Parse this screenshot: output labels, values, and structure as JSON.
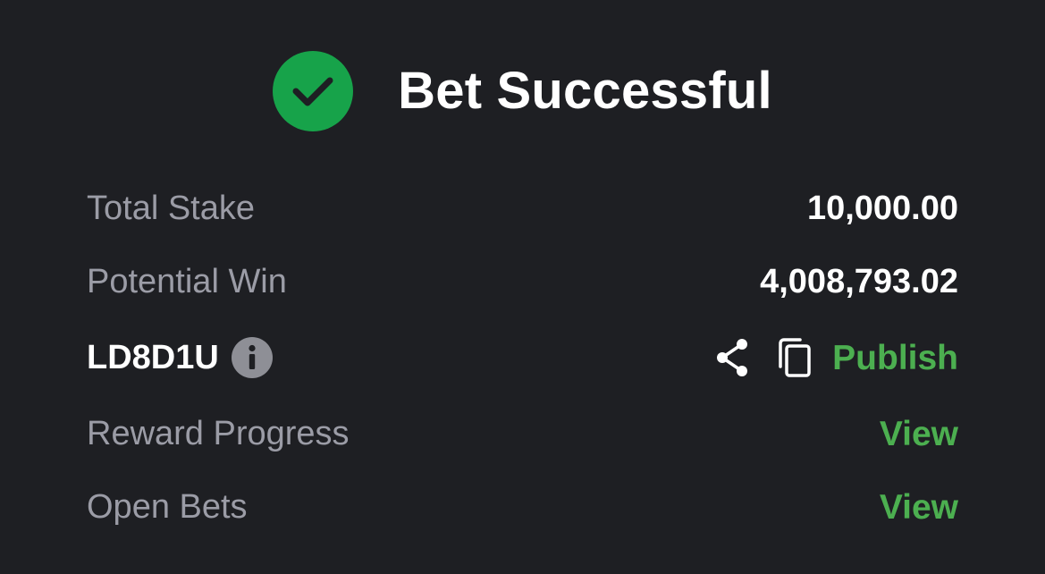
{
  "header": {
    "title": "Bet Successful"
  },
  "summary": {
    "total_stake_label": "Total Stake",
    "total_stake_value": "10,000.00",
    "potential_win_label": "Potential Win",
    "potential_win_value": "4,008,793.02"
  },
  "booking": {
    "code": "LD8D1U",
    "publish_label": "Publish"
  },
  "links": {
    "reward_progress_label": "Reward Progress",
    "reward_progress_action": "View",
    "open_bets_label": "Open Bets",
    "open_bets_action": "View"
  },
  "icons": {
    "success": "check-circle-icon",
    "info": "info-icon",
    "share": "share-icon",
    "copy": "copy-icon"
  },
  "colors": {
    "background": "#1e1f23",
    "success": "#17a34a",
    "accent_green": "#4caf50",
    "muted_text": "#9b9ca6"
  }
}
